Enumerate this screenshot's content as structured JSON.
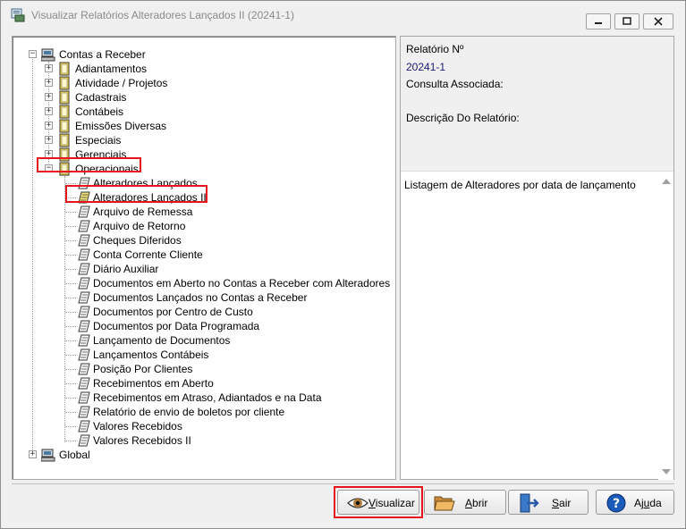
{
  "window": {
    "title": "Visualizar Relatórios Alteradores  Lançados II (20241-1)"
  },
  "tree": {
    "root": "Contas a Receber",
    "categories": [
      "Adiantamentos",
      "Atividade / Projetos",
      "Cadastrais",
      "Contábeis",
      "Emissões Diversas",
      "Especiais",
      "Gerenciais",
      "Operacionais"
    ],
    "operacionais_reports": [
      "Alteradores  Lançados",
      "Alteradores  Lançados II",
      "Arquivo de Remessa",
      "Arquivo de Retorno",
      "Cheques Diferidos",
      "Conta Corrente Cliente",
      "Diário  Auxiliar",
      "Documentos em Aberto no Contas a Receber com Alteradores",
      "Documentos Lançados no Contas a Receber",
      "Documentos por Centro de Custo",
      "Documentos por Data Programada",
      "Lançamento  de Documentos",
      "Lançamentos Contábeis",
      "Posição Por Clientes",
      "Recebimentos em Aberto",
      "Recebimentos em Atraso, Adiantados e na Data",
      "Relatório de envio de boletos por cliente",
      "Valores Recebidos",
      "Valores Recebidos II"
    ],
    "global": "Global"
  },
  "info": {
    "report_number_label": "Relatório Nº",
    "report_number": "20241-1",
    "query_label": "Consulta Associada:",
    "description_label": "Descrição Do Relatório:",
    "description": "Listagem de Alteradores por data de lançamento"
  },
  "buttons": {
    "visualizar_first": "V",
    "visualizar_rest": "isualizar",
    "abrir_first": "A",
    "abrir_rest": "brir",
    "sair_first": "S",
    "sair_rest": "air",
    "ajuda_first": "Aj",
    "ajuda_u": "u",
    "ajuda_rest": "da"
  },
  "colors": {
    "highlight": "#e8141b",
    "value_text": "#1a1a7a",
    "folder": "#f5d94a"
  }
}
